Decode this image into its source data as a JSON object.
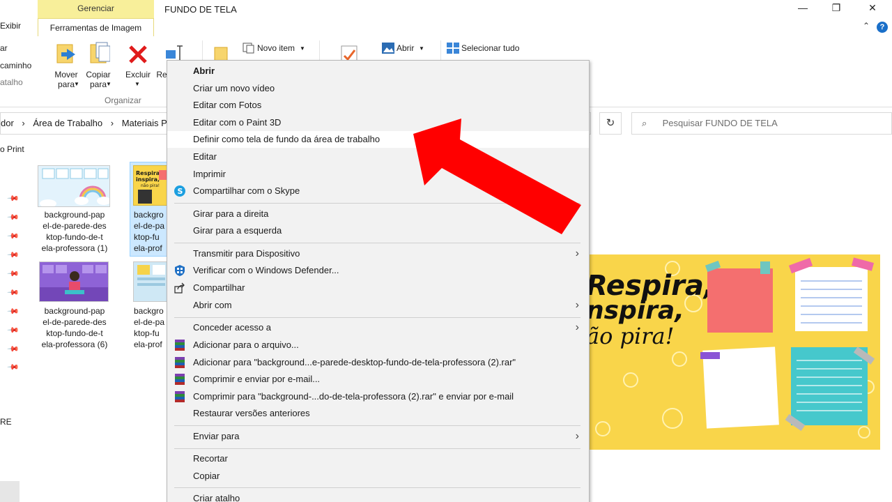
{
  "window": {
    "title": "FUNDO DE TELA",
    "manage_tab": "Gerenciar",
    "image_tools_tab": "Ferramentas de Imagem",
    "view_tab": "Exibir",
    "btn_minimize": "—",
    "btn_restore": "❐",
    "btn_close": "✕",
    "collapse_ribbon": "⌃",
    "help": "?"
  },
  "ribbon": {
    "left_items": [
      "ar",
      "caminho",
      "atalho"
    ],
    "move_to": "Mover para",
    "copy_to": "Copiar para",
    "delete": "Excluir",
    "rename_partial": "Re",
    "group_organize": "Organizar",
    "new_item": "Novo item",
    "open": "Abrir",
    "select_all": "Selecionar tudo"
  },
  "address": {
    "crumbs": [
      "dor",
      "Área de Trabalho",
      "Materiais Pe"
    ],
    "separator": "›",
    "refresh": "↻",
    "search_placeholder": "Pesquisar FUNDO DE TELA"
  },
  "quick_access": {
    "item": "o Print",
    "side_letter": "RE"
  },
  "files": [
    {
      "name1": "background-pap",
      "name2": "el-de-parede-des",
      "name3": "ktop-fundo-de-t",
      "name4": "ela-professora (1)"
    },
    {
      "name1": "backgro",
      "name2": "el-de-pa",
      "name3": "ktop-fu",
      "name4": "ela-prof"
    },
    {
      "name1": "background-pap",
      "name2": "el-de-parede-des",
      "name3": "ktop-fundo-de-t",
      "name4": "ela-professora (6)"
    },
    {
      "name1": "backgro",
      "name2": "el-de-pa",
      "name3": "ktop-fu",
      "name4": "ela-prof"
    }
  ],
  "thumb_text": {
    "line1": "Respira,",
    "line2": "inspira,",
    "line3": "não pira!"
  },
  "preview": {
    "line1": "Respira,",
    "line2": "nspira,",
    "line3": "ão pira!"
  },
  "menu": {
    "open": "Abrir",
    "new_video": "Criar um novo vídeo",
    "edit_photos": "Editar com Fotos",
    "edit_paint3d": "Editar com o Paint 3D",
    "set_wallpaper": "Definir como tela de fundo da área de trabalho",
    "edit": "Editar",
    "print": "Imprimir",
    "share_skype": "Compartilhar com o Skype",
    "rotate_right": "Girar para a direita",
    "rotate_left": "Girar para a esquerda",
    "cast": "Transmitir para Dispositivo",
    "defender": "Verificar com o Windows Defender...",
    "share": "Compartilhar",
    "open_with": "Abrir com",
    "give_access": "Conceder acesso a",
    "add_archive": "Adicionar para o arquivo...",
    "add_rar": "Adicionar para \"background...e-parede-desktop-fundo-de-tela-professora (2).rar\"",
    "compress_email": "Comprimir e enviar por e-mail...",
    "compress_rar_email": "Comprimir para \"background-...do-de-tela-professora (2).rar\" e enviar por e-mail",
    "restore_versions": "Restaurar versões anteriores",
    "send_to": "Enviar para",
    "cut": "Recortar",
    "copy": "Copiar",
    "create_shortcut": "Criar atalho",
    "submenu_arrow": "›"
  },
  "colors": {
    "accent_arrow": "#ff0000",
    "manage_tab": "#f8ef9a",
    "menu_bg": "#f2f2f2",
    "preview_bg": "#f9d54a"
  }
}
